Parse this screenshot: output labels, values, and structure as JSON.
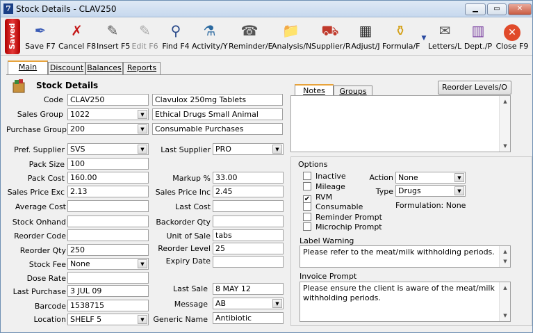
{
  "window": {
    "title": "Stock Details - CLAV250",
    "app_icon": "7"
  },
  "toolbar": {
    "saved": "Saved",
    "buttons": [
      {
        "label": "Save F7",
        "icon": "pen-icon"
      },
      {
        "label": "Cancel F8",
        "icon": "cancel-x-icon"
      },
      {
        "label": "Insert F5",
        "icon": "insert-pencil-icon"
      },
      {
        "label": "Edit F6",
        "icon": "edit-icon"
      },
      {
        "label": "Find F4",
        "icon": "magnifier-icon"
      },
      {
        "label": "Activity/Y",
        "icon": "activity-icon"
      },
      {
        "label": "Reminder/E",
        "icon": "reminder-icon"
      },
      {
        "label": "Analysis/N",
        "icon": "analysis-icon"
      },
      {
        "label": "Supplier/R",
        "icon": "truck-icon"
      },
      {
        "label": "Adjust/J",
        "icon": "adjust-icon"
      },
      {
        "label": "Formula/F",
        "icon": "formula-icon"
      },
      {
        "label": "Letters/L",
        "icon": "letters-icon"
      },
      {
        "label": "Dept./P",
        "icon": "dept-icon"
      },
      {
        "label": "Close F9",
        "icon": "close-circle-icon"
      }
    ]
  },
  "tabs": [
    "Main",
    "Discount",
    "Balances",
    "Reports"
  ],
  "section_title": "Stock Details",
  "form": {
    "code_label": "Code",
    "code": "CLAV250",
    "description": "Clavulox 250mg Tablets",
    "sales_group_label": "Sales Group",
    "sales_group": "1022",
    "sales_group_desc": "Ethical Drugs Small Animal",
    "purchase_group_label": "Purchase Group",
    "purchase_group": "200",
    "purchase_group_desc": "Consumable Purchases",
    "pref_supplier_label": "Pref. Supplier",
    "pref_supplier": "SVS",
    "last_supplier_label": "Last Supplier",
    "last_supplier": "PRO",
    "pack_size_label": "Pack Size",
    "pack_size": "100",
    "pack_cost_label": "Pack Cost",
    "pack_cost": "160.00",
    "markup_label": "Markup %",
    "markup": "33.00",
    "sales_price_exc_label": "Sales Price Exc",
    "sales_price_exc": "2.13",
    "sales_price_inc_label": "Sales Price Inc",
    "sales_price_inc": "2.45",
    "average_cost_label": "Average Cost",
    "average_cost": "",
    "last_cost_label": "Last Cost",
    "last_cost": "",
    "stock_onhand_label": "Stock Onhand",
    "stock_onhand": "",
    "backorder_qty_label": "Backorder Qty",
    "backorder_qty": "",
    "reorder_code_label": "Reorder Code",
    "reorder_code": "",
    "unit_of_sale_label": "Unit of Sale",
    "unit_of_sale": "tabs",
    "reorder_qty_label": "Reorder Qty",
    "reorder_qty": "250",
    "reorder_level_label": "Reorder Level",
    "reorder_level": "25",
    "stock_fee_label": "Stock Fee",
    "stock_fee": "None",
    "expiry_date_label": "Expiry Date",
    "expiry_date": "",
    "dose_rate_label": "Dose Rate",
    "dose_rate": "",
    "last_purchase_label": "Last Purchase",
    "last_purchase": "3 JUL 09",
    "last_sale_label": "Last Sale",
    "last_sale": "8 MAY 12",
    "barcode_label": "Barcode",
    "barcode": "1538715",
    "message_label": "Message",
    "message": "AB",
    "location_label": "Location",
    "location": "SHELF 5",
    "generic_name_label": "Generic Name",
    "generic_name": "Antibiotic"
  },
  "right": {
    "tabs": [
      "Notes",
      "Groups"
    ],
    "reorder_button": "Reorder Levels/O",
    "notes": "",
    "options_title": "Options",
    "checkboxes": [
      {
        "label": "Inactive",
        "checked": false
      },
      {
        "label": "Mileage",
        "checked": false
      },
      {
        "label": "RVM",
        "checked": true
      },
      {
        "label": "Consumable",
        "checked": false
      },
      {
        "label": "Reminder Prompt",
        "checked": false
      },
      {
        "label": "Microchip Prompt",
        "checked": false
      }
    ],
    "check_mark": "✔",
    "action_label": "Action",
    "action": "None",
    "type_label": "Type",
    "type": "Drugs",
    "formulation": "Formulation: None",
    "label_warning_title": "Label Warning",
    "label_warning": "Please refer to the meat/milk withholding periods.",
    "invoice_prompt_title": "Invoice Prompt",
    "invoice_prompt": "Please ensure the client is aware of the meat/milk withholding periods."
  }
}
